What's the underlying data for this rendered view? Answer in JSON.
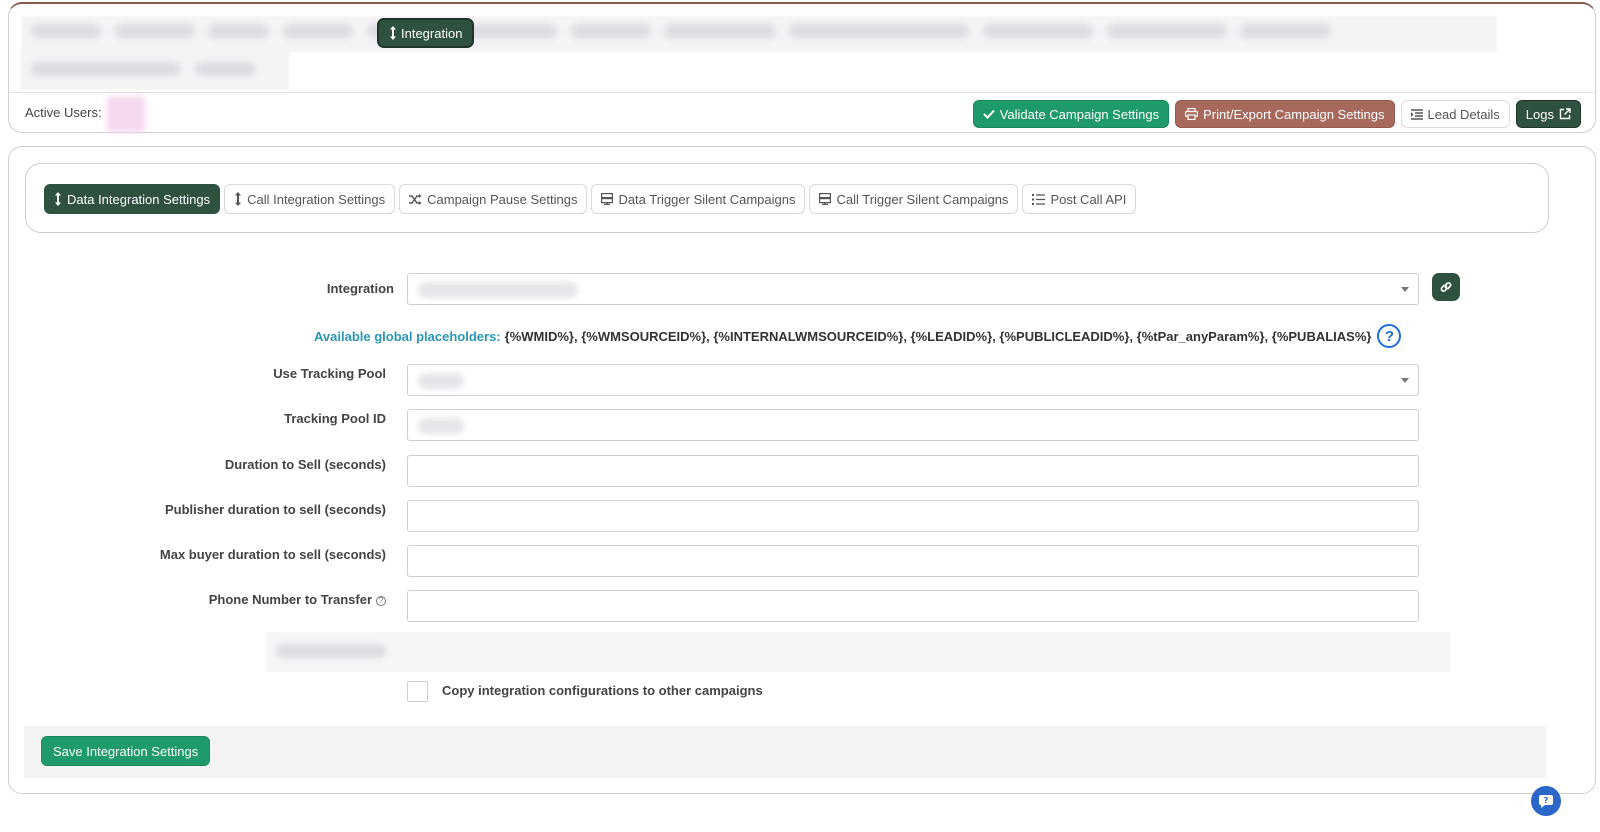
{
  "header": {
    "integration_tab_label": "Integration",
    "active_users_label": "Active Users:",
    "actions": {
      "validate": "Validate Campaign Settings",
      "print_export": "Print/Export Campaign Settings",
      "lead_details": "Lead Details",
      "logs": "Logs"
    }
  },
  "tabs": [
    {
      "label": "Data Integration Settings",
      "icon": "arrows-vertical-icon",
      "active": true
    },
    {
      "label": "Call Integration Settings",
      "icon": "arrows-vertical-icon",
      "active": false
    },
    {
      "label": "Campaign Pause Settings",
      "icon": "shuffle-icon",
      "active": false
    },
    {
      "label": "Data Trigger Silent Campaigns",
      "icon": "server-icon",
      "active": false
    },
    {
      "label": "Call Trigger Silent Campaigns",
      "icon": "server-icon",
      "active": false
    },
    {
      "label": "Post Call API",
      "icon": "list-icon",
      "active": false
    }
  ],
  "form": {
    "integration_label": "Integration",
    "placeholders_label": "Available global placeholders:",
    "placeholders_values": "{%WMID%}, {%WMSOURCEID%}, {%INTERNALWMSOURCEID%}, {%LEADID%}, {%PUBLICLEADID%}, {%tPar_anyParam%}, {%PUBALIAS%}",
    "use_tracking_pool_label": "Use Tracking Pool",
    "tracking_pool_id_label": "Tracking Pool ID",
    "duration_to_sell_label": "Duration to Sell (seconds)",
    "publisher_duration_label": "Publisher duration to sell (seconds)",
    "max_buyer_duration_label": "Max buyer duration to sell (seconds)",
    "phone_number_label": "Phone Number to Transfer",
    "duration_to_sell_value": "",
    "publisher_duration_value": "",
    "max_buyer_duration_value": "",
    "phone_number_value": "",
    "copy_label": "Copy integration configurations to other campaigns",
    "save_label": "Save Integration Settings"
  },
  "colors": {
    "primary_dark": "#2f5240",
    "success": "#1f9a6a",
    "brown": "#a6695c",
    "link_teal": "#2a97b8",
    "help_blue": "#1e6fd9"
  }
}
